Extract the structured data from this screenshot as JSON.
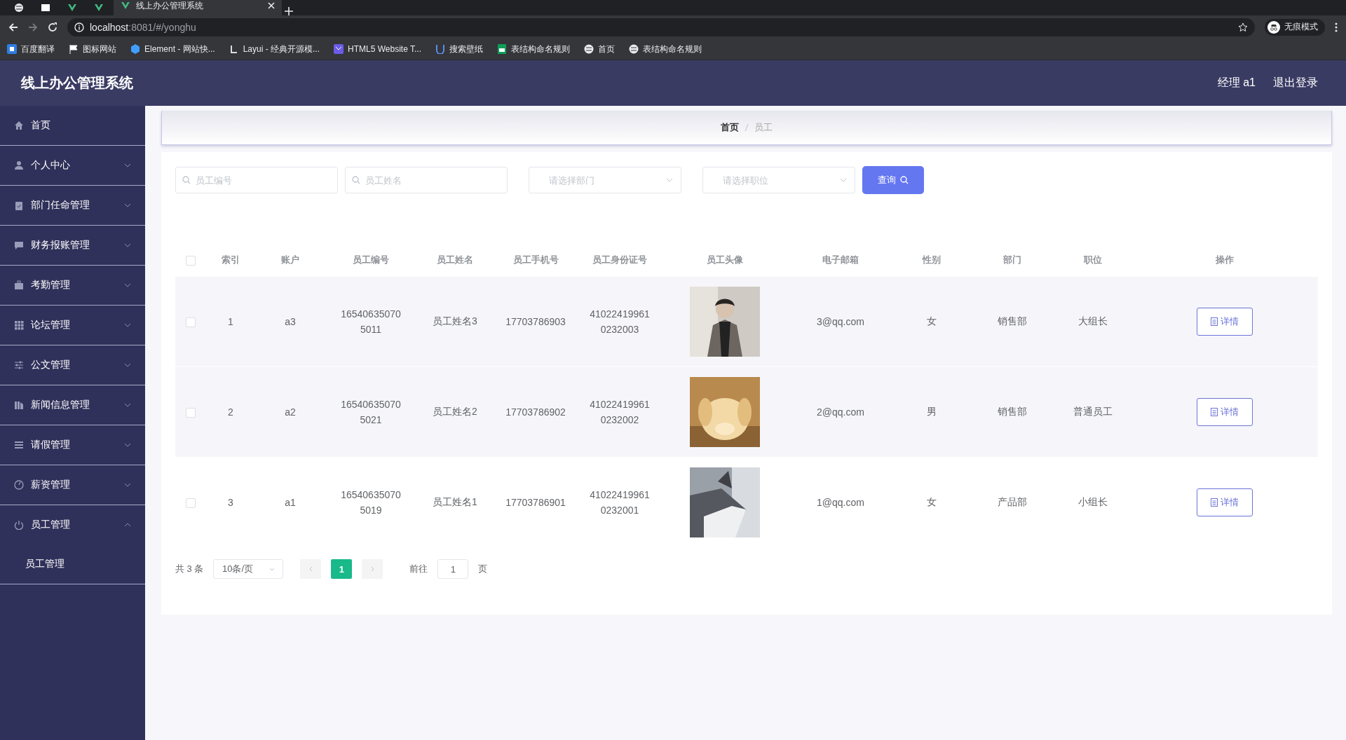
{
  "browser": {
    "tabs": [
      {
        "kind": "icon",
        "selected": false
      },
      {
        "kind": "icon",
        "selected": false
      },
      {
        "kind": "icon",
        "selected": false
      },
      {
        "kind": "icon",
        "selected": false
      },
      {
        "kind": "page",
        "title": "线上办公管理系统",
        "selected": true
      }
    ],
    "url_host": "localhost",
    "url_path": ":8081/#/yonghu",
    "profile_label": "无痕模式",
    "bookmarks": [
      "百度翻译",
      "图标网站",
      "Element - 网站快...",
      "Layui - 经典开源模...",
      "HTML5 Website T...",
      "搜索壁纸",
      "表结构命名规则",
      "首页",
      "表结构命名规则"
    ]
  },
  "header": {
    "title": "线上办公管理系统",
    "user": "经理 a1",
    "logout": "退出登录"
  },
  "sidebar": {
    "items": [
      {
        "label": "首页",
        "kind": "link"
      },
      {
        "label": "个人中心",
        "kind": "submenu",
        "expanded": false
      },
      {
        "label": "部门任命管理",
        "kind": "submenu",
        "expanded": false
      },
      {
        "label": "财务报账管理",
        "kind": "submenu",
        "expanded": false
      },
      {
        "label": "考勤管理",
        "kind": "submenu",
        "expanded": false
      },
      {
        "label": "论坛管理",
        "kind": "submenu",
        "expanded": false
      },
      {
        "label": "公文管理",
        "kind": "submenu",
        "expanded": false
      },
      {
        "label": "新闻信息管理",
        "kind": "submenu",
        "expanded": false
      },
      {
        "label": "请假管理",
        "kind": "submenu",
        "expanded": false
      },
      {
        "label": "薪资管理",
        "kind": "submenu",
        "expanded": false
      },
      {
        "label": "员工管理",
        "kind": "submenu",
        "expanded": true,
        "children": [
          {
            "label": "员工管理"
          }
        ]
      }
    ]
  },
  "breadcrumb": [
    "首页",
    "员工"
  ],
  "filters": [
    {
      "kind": "search",
      "placeholder": "员工编号"
    },
    {
      "kind": "search",
      "placeholder": "员工姓名"
    },
    {
      "kind": "select",
      "placeholder": "请选择部门"
    },
    {
      "kind": "select",
      "placeholder": "请选择职位"
    }
  ],
  "query_button": "查询",
  "table": {
    "select_all": false,
    "columns": [
      "索引",
      "账户",
      "员工编号",
      "员工姓名",
      "员工手机号",
      "员工身份证号",
      "员工头像",
      "电子邮箱",
      "性别",
      "部门",
      "职位",
      "操作"
    ],
    "rows": [
      {
        "selected": false,
        "index": "1",
        "account": "a3",
        "number": "165406350705011",
        "name": "员工姓名3",
        "phone": "17703786903",
        "id_card": "410224199610232003",
        "email": "3@qq.com",
        "gender": "女",
        "department": "销售部",
        "position": "大组长",
        "action": "详情"
      },
      {
        "selected": false,
        "index": "2",
        "account": "a2",
        "number": "165406350705021",
        "name": "员工姓名2",
        "phone": "17703786902",
        "id_card": "410224199610232002",
        "email": "2@qq.com",
        "gender": "男",
        "department": "销售部",
        "position": "普通员工",
        "action": "详情"
      },
      {
        "selected": false,
        "index": "3",
        "account": "a1",
        "number": "165406350705019",
        "name": "员工姓名1",
        "phone": "17703786901",
        "id_card": "410224199610232001",
        "email": "1@qq.com",
        "gender": "女",
        "department": "产品部",
        "position": "小组长",
        "action": "详情"
      }
    ]
  },
  "pager": {
    "total": "共 3 条",
    "page_size": "10条/页",
    "pages": [
      {
        "label": "1",
        "selected": true
      }
    ],
    "goto_label": "前往",
    "goto_value": "1",
    "page_unit": "页"
  }
}
